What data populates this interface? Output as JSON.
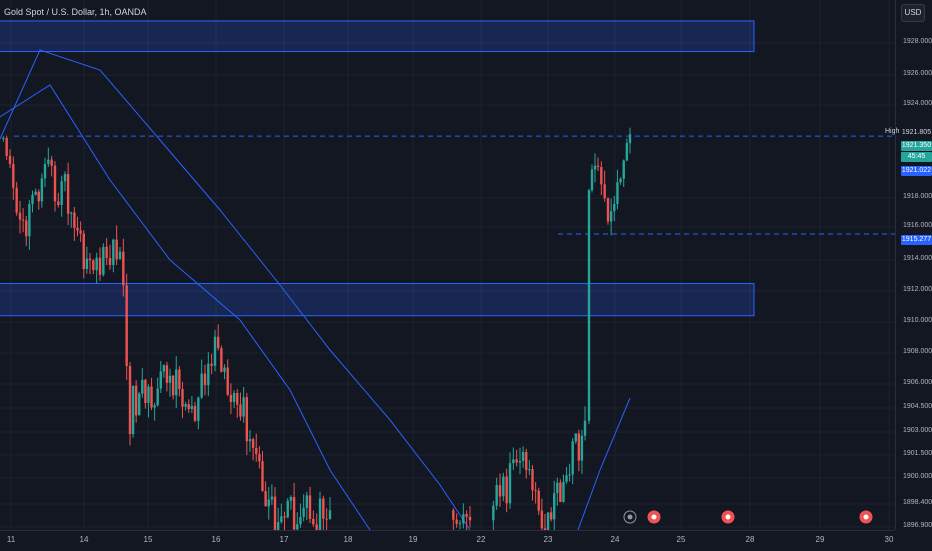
{
  "header": {
    "symbol_title": "Gold Spot / U.S. Dollar, 1h, OANDA",
    "currency": "USD"
  },
  "colors": {
    "background": "#131722",
    "bull": "#26a69a",
    "bear": "#ef5350",
    "ma": "#2962ff",
    "zone": "#2962ff"
  },
  "price_axis": {
    "labels": [
      "1928.000",
      "1926.000",
      "1924.000",
      "1918.000",
      "1916.000",
      "1914.000",
      "1912.000",
      "1910.000",
      "1908.000",
      "1906.000",
      "1904.500",
      "1903.000",
      "1901.500",
      "1900.000",
      "1898.400",
      "1896.900"
    ],
    "high_label": "High",
    "badges": {
      "high": "1921.805",
      "current": "1921.350",
      "countdown": "45:45",
      "bid": "1921.022",
      "level": "1915.277"
    }
  },
  "time_axis": {
    "labels": [
      "11",
      "14",
      "15",
      "16",
      "17",
      "18",
      "19",
      "22",
      "23",
      "24",
      "25",
      "28",
      "29",
      "30"
    ]
  },
  "events": {
    "icons": [
      "dividend-icon",
      "earnings-icon",
      "earnings-icon",
      "earnings-icon"
    ]
  },
  "chart_data": {
    "type": "candlestick",
    "ylim": [
      1896.9,
      1929.8
    ],
    "zones": [
      {
        "from": 1926.6,
        "to": 1928.5
      },
      {
        "from": 1910.2,
        "to": 1912.2
      }
    ],
    "horizontal_levels": [
      1921.35,
      1915.277
    ],
    "segments": [
      {
        "days": "11-19",
        "trend": "down",
        "open": 1921.0,
        "close": 1897.5,
        "min": 1896.9,
        "max": 1922.0
      },
      {
        "days": "22-23",
        "trend": "up",
        "open": 1896.9,
        "close": 1903.2,
        "min": 1896.9,
        "max": 1904.5
      },
      {
        "days": "23-24",
        "trend": "spike",
        "open": 1903.2,
        "close": 1921.35,
        "min": 1902.9,
        "max": 1921.805
      }
    ]
  }
}
